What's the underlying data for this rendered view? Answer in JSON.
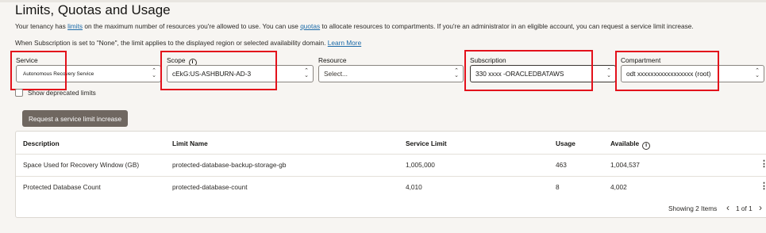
{
  "page": {
    "title": "Limits, Quotas and Usage",
    "intro": {
      "pre": "Your tenancy has ",
      "link1": "limits",
      "mid": " on the maximum number of resources you're allowed to use. You can use ",
      "link2": "quotas",
      "post": " to allocate resources to compartments. If you're an administrator in an eligible account, you can request a service limit increase."
    },
    "note": {
      "text": "When Subscription is set to \"None\", the limit applies to the displayed region or selected availability domain. ",
      "link": "Learn More"
    }
  },
  "filters": {
    "service": {
      "label": "Service",
      "value": "Autonomous Recovery Service"
    },
    "scope": {
      "label": "Scope",
      "value": "cEkG:US-ASHBURN-AD-3"
    },
    "resource": {
      "label": "Resource",
      "placeholder": "Select..."
    },
    "subscription": {
      "label": "Subscription",
      "value": "330  xxxx  -ORACLEDBATAWS"
    },
    "compartment": {
      "label": "Compartment",
      "value": "odt  xxxxxxxxxxxxxxxxx    (root)"
    }
  },
  "show_deprecated_label": "Show deprecated limits",
  "request_button": "Request a service limit increase",
  "table": {
    "headers": [
      "Description",
      "Limit Name",
      "Service Limit",
      "Usage",
      "Available"
    ],
    "rows": [
      [
        "Space Used for Recovery Window (GB)",
        "protected-database-backup-storage-gb",
        "1,005,000",
        "463",
        "1,004,537"
      ],
      [
        "Protected Database Count",
        "protected-database-count",
        "4,010",
        "8",
        "4,002"
      ]
    ]
  },
  "footer": {
    "showing": "Showing 2 Items",
    "page": "1 of 1"
  },
  "icons": {
    "info": "info-icon",
    "chevron": "chevron-up-down-icon",
    "kebab": "kebab-menu-icon"
  },
  "colors": {
    "highlight_border": "#e3111b",
    "link": "#1b6aa8",
    "button_bg": "#6f6760"
  }
}
